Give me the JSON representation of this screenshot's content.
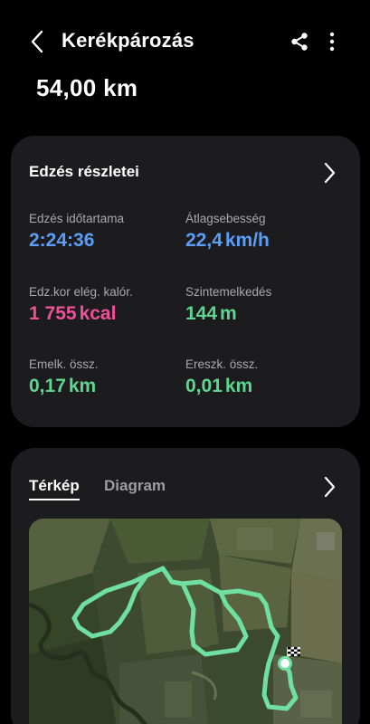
{
  "header": {
    "title": "Kerékpározás",
    "back_icon": "chevron-left-icon",
    "share_icon": "share-icon",
    "more_icon": "more-vertical-icon"
  },
  "summary": {
    "distance": "54,00 km"
  },
  "details": {
    "title": "Edzés részletei",
    "stats": [
      {
        "label": "Edzés időtartama",
        "value": "2:24:36",
        "unit": "",
        "color": "#5a9ef5"
      },
      {
        "label": "Átlagsebesség",
        "value": "22,4",
        "unit": "km/h",
        "color": "#5a9ef5"
      },
      {
        "label": "Edz.kor elég. kalór.",
        "value": "1 755",
        "unit": "kcal",
        "color": "#f0509a"
      },
      {
        "label": "Szintemelkedés",
        "value": "144",
        "unit": "m",
        "color": "#5fd690"
      },
      {
        "label": "Emelk. össz.",
        "value": "0,17",
        "unit": "km",
        "color": "#5fd690"
      },
      {
        "label": "Ereszk. össz.",
        "value": "0,01",
        "unit": "km",
        "color": "#5fd690"
      }
    ]
  },
  "map_card": {
    "tabs": [
      {
        "label": "Térkép",
        "active": true
      },
      {
        "label": "Diagram",
        "active": false
      }
    ],
    "route_color": "#6fe0a0",
    "map_kind": "satellite"
  }
}
